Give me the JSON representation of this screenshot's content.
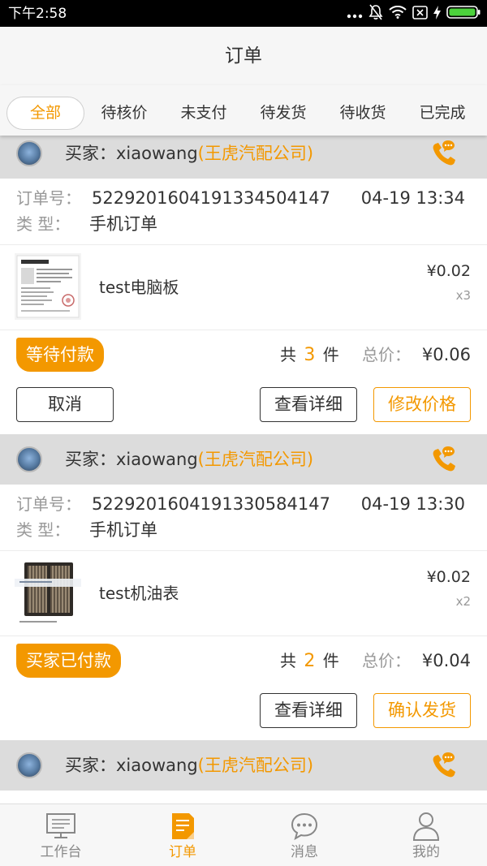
{
  "status_bar": {
    "time": "下午2:58"
  },
  "header": {
    "title": "订单"
  },
  "tabs": [
    {
      "label": "全部",
      "active": true
    },
    {
      "label": "待核价"
    },
    {
      "label": "未支付"
    },
    {
      "label": "待发货"
    },
    {
      "label": "待收货"
    },
    {
      "label": "已完成"
    }
  ],
  "orders": [
    {
      "buyer": {
        "prefix": "买家：",
        "name": "xiaowang",
        "company": "(王虎汽配公司)"
      },
      "order_no_label": "订单号：",
      "order_no": "5229201604191334504147",
      "time": "04-19 13:34",
      "type_label": "类 型：",
      "type": "手机订单",
      "product": {
        "name": "test电脑板",
        "price": "¥0.02",
        "qty": "x3"
      },
      "status": "等待付款",
      "summary": {
        "count_prefix": "共",
        "count": "3",
        "count_suffix": "件",
        "total_label": "总价：",
        "total": "¥0.06"
      },
      "buttons": [
        {
          "label": "取消"
        },
        {
          "label": "查看详细"
        },
        {
          "label": "修改价格"
        }
      ]
    },
    {
      "buyer": {
        "prefix": "买家：",
        "name": "xiaowang",
        "company": "(王虎汽配公司)"
      },
      "order_no_label": "订单号：",
      "order_no": "5229201604191330584147",
      "time": "04-19 13:30",
      "type_label": "类 型：",
      "type": "手机订单",
      "product": {
        "name": "test机油表",
        "price": "¥0.02",
        "qty": "x2"
      },
      "status": "买家已付款",
      "summary": {
        "count_prefix": "共",
        "count": "2",
        "count_suffix": "件",
        "total_label": "总价：",
        "total": "¥0.04"
      },
      "buttons": [
        {
          "label": "查看详细"
        },
        {
          "label": "确认发货"
        }
      ]
    },
    {
      "buyer": {
        "prefix": "买家：",
        "name": "xiaowang",
        "company": "(王虎汽配公司)"
      }
    }
  ],
  "bottom_nav": [
    {
      "label": "工作台",
      "icon": "monitor-icon"
    },
    {
      "label": "订单",
      "icon": "order-document-icon",
      "active": true
    },
    {
      "label": "消息",
      "icon": "message-bubble-icon"
    },
    {
      "label": "我的",
      "icon": "person-icon"
    }
  ],
  "colors": {
    "accent": "#F39800",
    "buyer_row_bg": "#DCDCDC",
    "status_bar_bg": "#000000"
  }
}
